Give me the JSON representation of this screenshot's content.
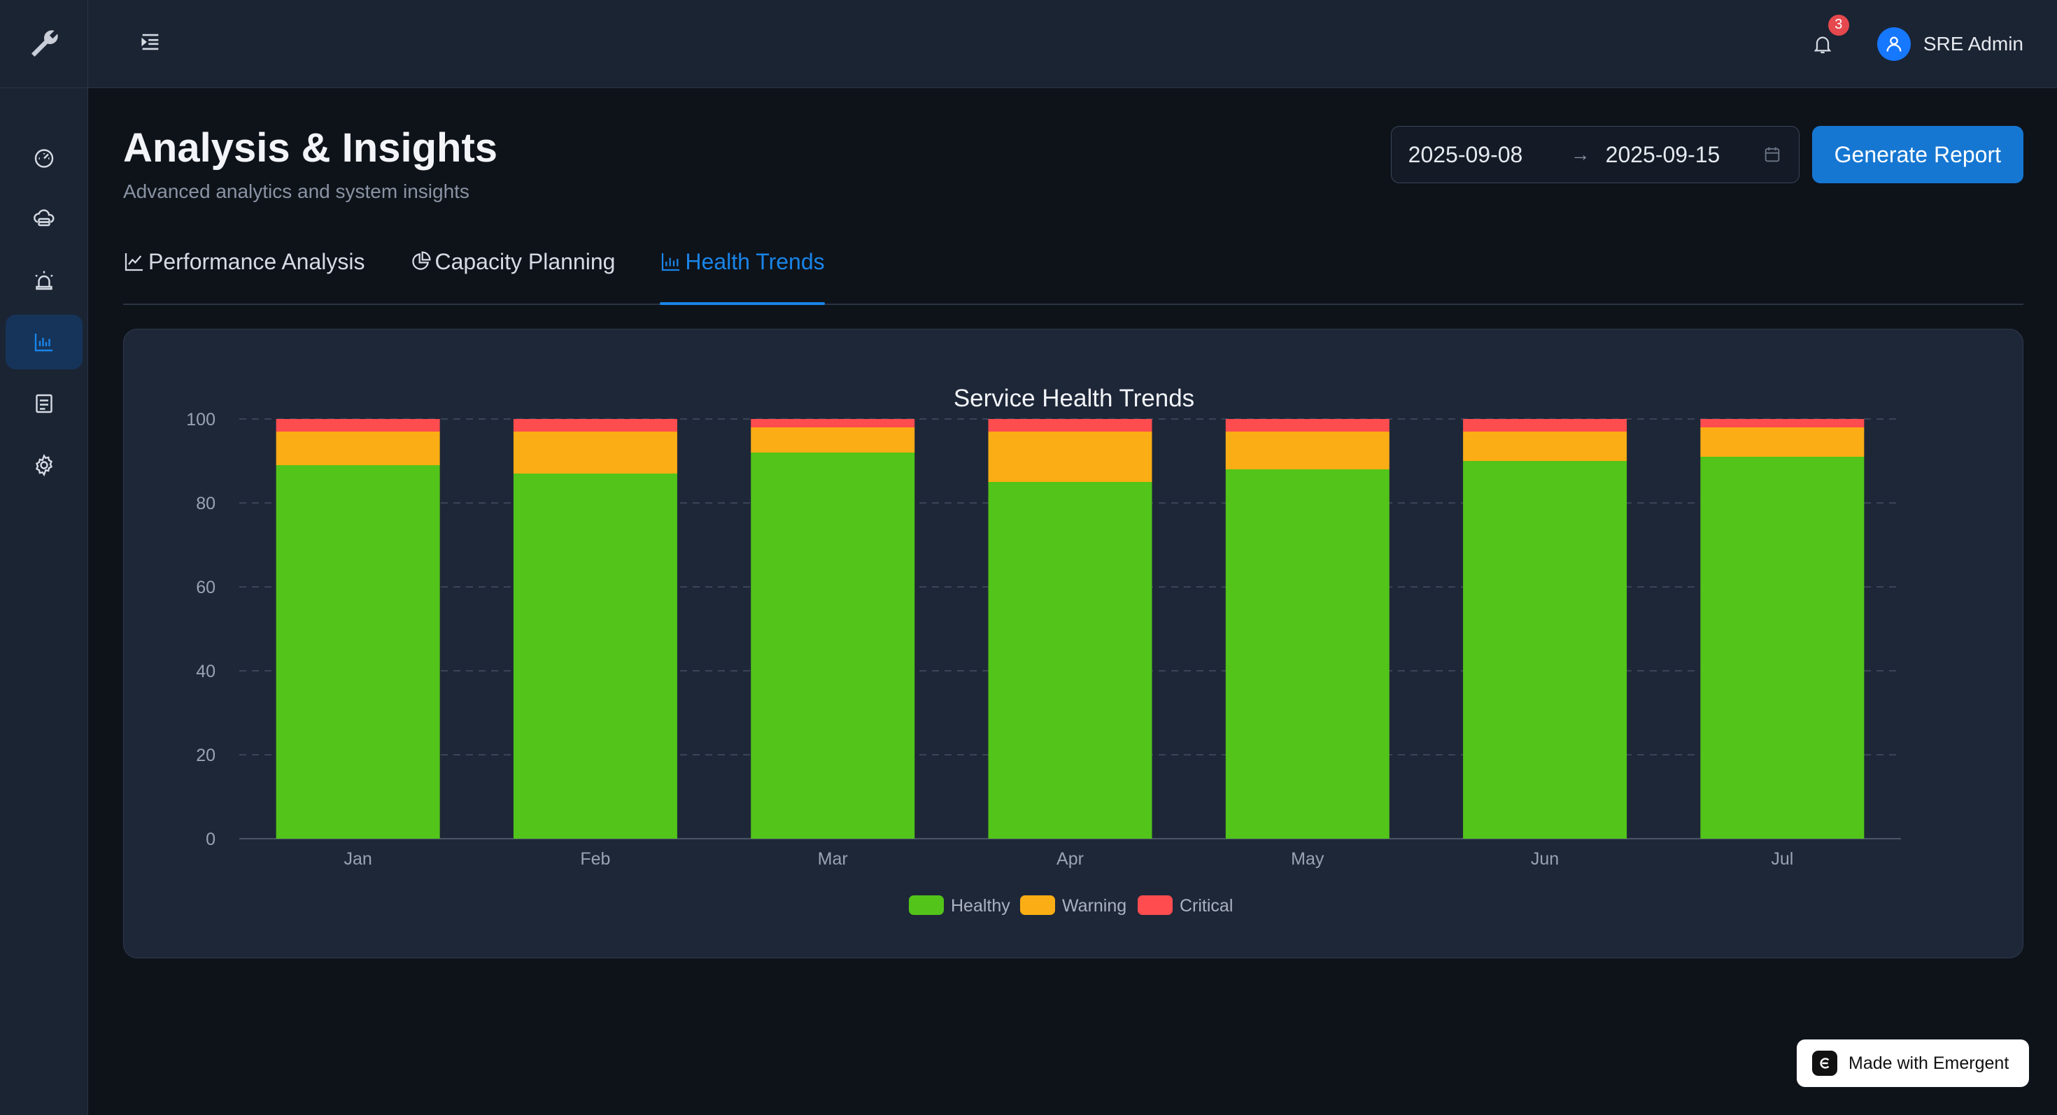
{
  "header": {
    "notifications_count": "3",
    "user_name": "SRE Admin"
  },
  "page": {
    "title": "Analysis & Insights",
    "subtitle": "Advanced analytics and system insights",
    "date_start": "2025-09-08",
    "date_arrow": "→",
    "date_end": "2025-09-15",
    "generate_label": "Generate Report"
  },
  "tabs": [
    {
      "label": "Performance Analysis",
      "icon": "line-chart-icon",
      "active": false
    },
    {
      "label": "Capacity Planning",
      "icon": "pie-chart-icon",
      "active": false
    },
    {
      "label": "Health Trends",
      "icon": "bar-chart-icon",
      "active": true
    }
  ],
  "sidebar": {
    "items": [
      {
        "icon": "dashboard-icon",
        "active": false
      },
      {
        "icon": "cloud-server-icon",
        "active": false
      },
      {
        "icon": "alert-icon",
        "active": false
      },
      {
        "icon": "bar-chart-icon",
        "active": true
      },
      {
        "icon": "report-icon",
        "active": false
      },
      {
        "icon": "settings-icon",
        "active": false
      }
    ]
  },
  "colors": {
    "accent": "#1677d2",
    "healthy": "#52c41a",
    "warning": "#faad14",
    "critical": "#ff4d4f"
  },
  "chart_data": {
    "type": "bar",
    "stacked": true,
    "title": "Service Health Trends",
    "categories": [
      "Jan",
      "Feb",
      "Mar",
      "Apr",
      "May",
      "Jun",
      "Jul"
    ],
    "series": [
      {
        "name": "Healthy",
        "values": [
          89,
          87,
          92,
          85,
          88,
          90,
          91
        ]
      },
      {
        "name": "Warning",
        "values": [
          8,
          10,
          6,
          12,
          9,
          7,
          7
        ]
      },
      {
        "name": "Critical",
        "values": [
          3,
          3,
          2,
          3,
          3,
          3,
          2
        ]
      }
    ],
    "ylim": [
      0,
      100
    ],
    "yticks": [
      0,
      20,
      40,
      60,
      80,
      100
    ],
    "grid": true,
    "legend": "bottom"
  },
  "footer": {
    "made_with": "Made with Emergent"
  }
}
